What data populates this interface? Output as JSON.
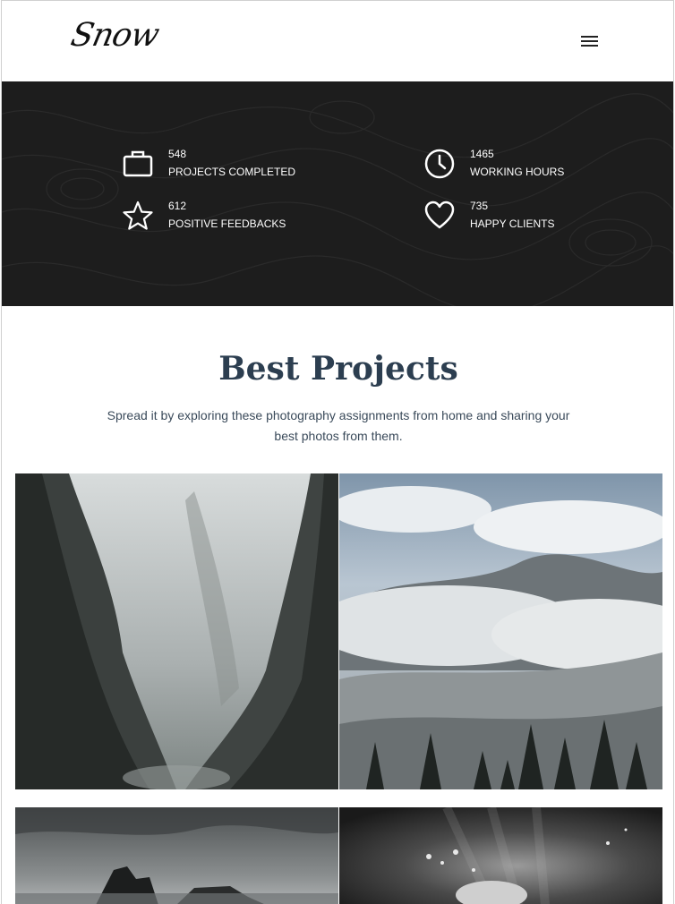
{
  "header": {
    "logo": "Snow",
    "menu_icon": "hamburger-menu-icon"
  },
  "stats": [
    {
      "icon": "briefcase-icon",
      "value": "548",
      "label": "PROJECTS COMPLETED"
    },
    {
      "icon": "clock-icon",
      "value": "1465",
      "label": "WORKING HOURS"
    },
    {
      "icon": "star-icon",
      "value": "612",
      "label": "POSITIVE FEEDBACKS"
    },
    {
      "icon": "heart-icon",
      "value": "735",
      "label": "HAPPY CLIENTS"
    }
  ],
  "projects": {
    "title": "Best Projects",
    "subtitle": "Spread it by exploring these photography assignments from home and sharing your best photos from them."
  },
  "colors": {
    "stats_bg": "#1d1d1d",
    "title": "#2c3e50"
  }
}
